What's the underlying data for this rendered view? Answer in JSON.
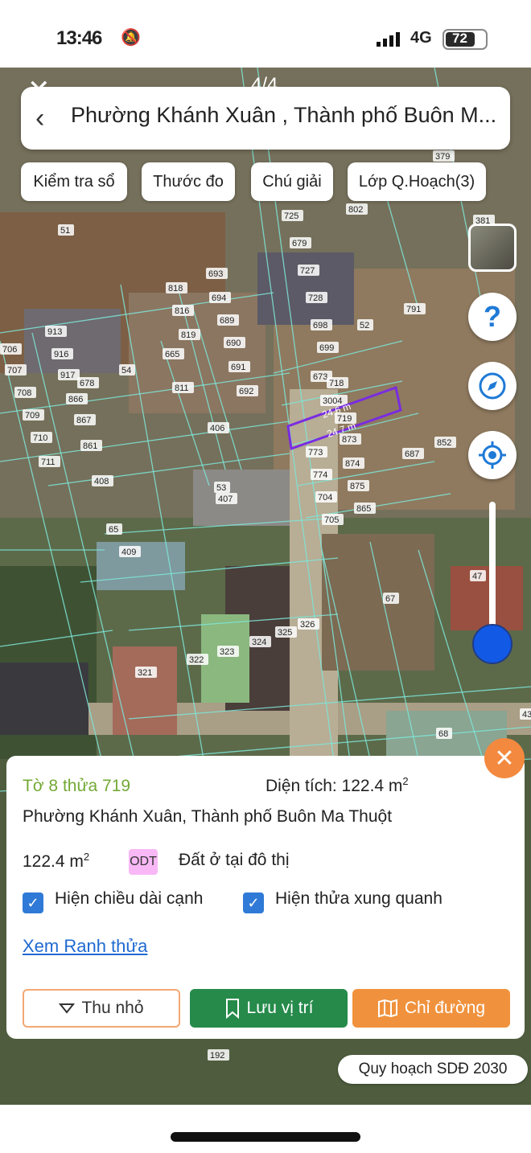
{
  "status_bar": {
    "time": "13:46",
    "network": "4G",
    "battery": "72"
  },
  "map": {
    "page_counter": "4/4",
    "location_title": "Phường Khánh Xuân , Thành phố Buôn M...",
    "chips": [
      "Kiểm tra sổ",
      "Thước đo",
      "Chú giải",
      "Lớp Q.Hoạch(3)"
    ],
    "parcel_numbers": [
      "51",
      "725",
      "802",
      "679",
      "727",
      "728",
      "698",
      "52",
      "699",
      "791",
      "818",
      "816",
      "819",
      "665",
      "693",
      "694",
      "689",
      "690",
      "691",
      "692",
      "811",
      "913",
      "916",
      "917",
      "54",
      "678",
      "866",
      "867",
      "861",
      "706",
      "707",
      "708",
      "709",
      "710",
      "711",
      "673",
      "718",
      "3004",
      "719",
      "873",
      "773",
      "874",
      "774",
      "875",
      "704",
      "865",
      "705",
      "687",
      "852",
      "406",
      "408",
      "53",
      "407",
      "65",
      "409",
      "67",
      "47",
      "326",
      "325",
      "324",
      "323",
      "322",
      "321",
      "68",
      "192",
      "379",
      "381",
      "43"
    ],
    "edge_labels": [
      "24.6 m",
      "24.7 m"
    ],
    "plan_label": "Quy hoạch SDĐ 2030",
    "icons": [
      "close-icon",
      "back-icon",
      "layers-icon",
      "help-icon",
      "compass-icon",
      "locate-icon",
      "zoom-slider"
    ]
  },
  "panel": {
    "title": "Tờ 8 thửa 719",
    "area_label": "Diện tích: 122.4 m",
    "area_sup": "2",
    "address": "Phường Khánh Xuân, Thành phố Buôn Ma Thuột",
    "size_value": "122.4 m",
    "size_sup": "2",
    "land_code": "ODT",
    "land_use": "Đất ở tại đô thị",
    "checkbox1": "Hiện chiều dài cạnh",
    "checkbox2": "Hiện thửa xung quanh",
    "link": "Xem Ranh thửa",
    "btn_shrink": "Thu nhỏ",
    "btn_save": "Lưu vị trí",
    "btn_directions": "Chỉ đường"
  },
  "colors": {
    "parcel_line": "#7ee6d8",
    "highlight": "#7a2ce0",
    "title_green": "#73a935",
    "save_green": "#258a4a",
    "orange": "#f0923d"
  }
}
